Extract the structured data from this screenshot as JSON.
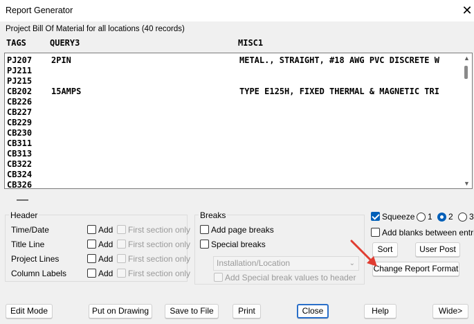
{
  "window": {
    "title": "Report Generator",
    "close_glyph": "✕"
  },
  "report": {
    "subtitle": "Project Bill Of Material for all locations (40 records)",
    "columns": [
      "TAGS",
      "QUERY3",
      "MISC1"
    ],
    "rows": [
      {
        "tag": "PJ207",
        "query3": "2PIN",
        "misc1": "METAL., STRAIGHT, #18 AWG PVC DISCRETE W"
      },
      {
        "tag": "PJ211",
        "query3": "",
        "misc1": ""
      },
      {
        "tag": "PJ215",
        "query3": "",
        "misc1": ""
      },
      {
        "tag": "CB202",
        "query3": "15AMPS",
        "misc1": "TYPE E125H, FIXED THERMAL & MAGNETIC TRI"
      },
      {
        "tag": "CB226",
        "query3": "",
        "misc1": ""
      },
      {
        "tag": "CB227",
        "query3": "",
        "misc1": ""
      },
      {
        "tag": "CB229",
        "query3": "",
        "misc1": ""
      },
      {
        "tag": "CB230",
        "query3": "",
        "misc1": ""
      },
      {
        "tag": "CB311",
        "query3": "",
        "misc1": ""
      },
      {
        "tag": "CB313",
        "query3": "",
        "misc1": ""
      },
      {
        "tag": "CB322",
        "query3": "",
        "misc1": ""
      },
      {
        "tag": "CB324",
        "query3": "",
        "misc1": ""
      },
      {
        "tag": "CB326",
        "query3": "",
        "misc1": ""
      }
    ]
  },
  "header_group": {
    "title": "Header",
    "add_label": "Add",
    "first_section_label": "First section only",
    "items": [
      "Time/Date",
      "Title Line",
      "Project Lines",
      "Column Labels"
    ]
  },
  "breaks_group": {
    "title": "Breaks",
    "add_page_breaks": "Add page breaks",
    "special_breaks": "Special breaks",
    "select_value": "Installation/Location",
    "add_special_values": "Add Special break values to header"
  },
  "options": {
    "squeeze": "Squeeze",
    "squeeze_checked": true,
    "radio_labels": [
      "1",
      "2",
      "3"
    ],
    "radio_selected": "2",
    "add_blanks": "Add blanks between entries"
  },
  "buttons": {
    "sort": "Sort",
    "user_post": "User Post",
    "change_format": "Change Report Format",
    "edit_mode": "Edit Mode",
    "put_on_drawing": "Put on Drawing",
    "save_to_file": "Save to File",
    "print": "Print",
    "close": "Close",
    "help": "Help",
    "wide": "Wide>"
  },
  "colors": {
    "accent": "#005fb8",
    "annotation_arrow": "#e03c31"
  }
}
